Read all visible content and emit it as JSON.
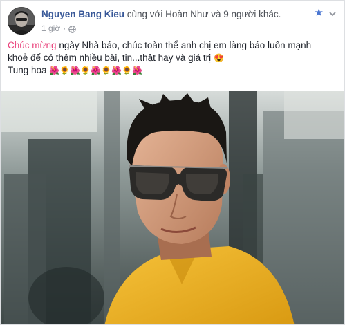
{
  "post": {
    "author": "Nguyen Bang Kieu",
    "with_text": "cùng với Hoàn Như và 9 người khác.",
    "time": "1 giờ",
    "time_sep": "·",
    "icons": {
      "privacy": "globe-icon",
      "favorite": "star-icon",
      "options": "chevron-down-icon"
    },
    "line1_highlight": "Chúc mừng",
    "line1_rest": "ngày Nhà báo, chúc toàn thể anh chị em làng báo luôn mạnh",
    "line2": "khoẻ để có thêm nhiều bài, tin...thật hay và giá trị",
    "line2_emoji": "😍",
    "line3": "Tung hoa",
    "flowers": [
      "🌺",
      "🌻",
      "🌺",
      "🌻",
      "🌺",
      "🌻",
      "🌺",
      "🌻",
      "🌺"
    ],
    "photo": "photo of a man wearing sunglasses and a yellow shirt"
  },
  "colors": {
    "author": "#385898",
    "highlight": "#e9407a",
    "meta": "#90949c",
    "star": "#4a76d1",
    "shirt": "#f0b41e"
  }
}
